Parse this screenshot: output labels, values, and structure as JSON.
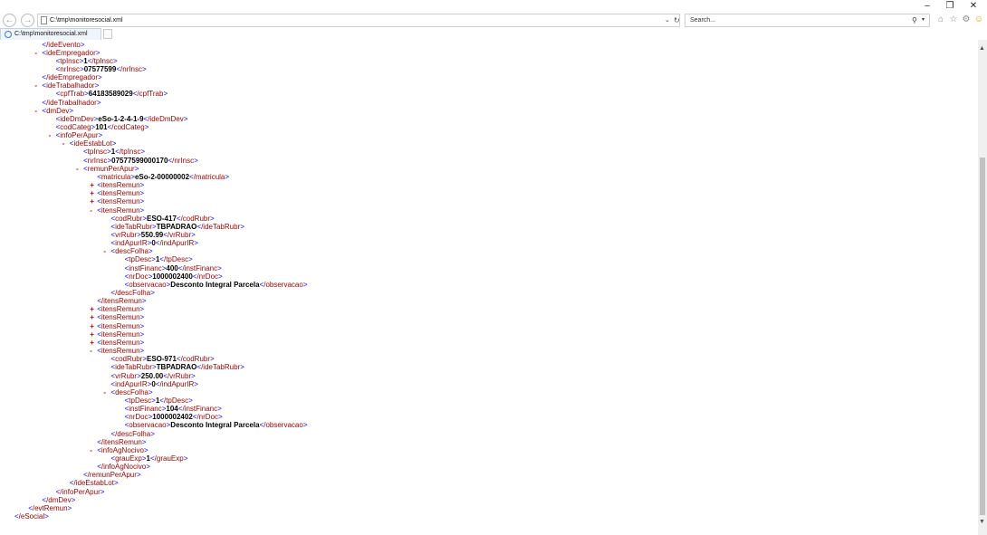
{
  "window": {
    "min_label": "–",
    "restore_label": "❐",
    "close_label": "✕"
  },
  "nav": {
    "back_label": "←",
    "forward_label": "→"
  },
  "address": {
    "url": "C:\\tmp\\monitoresocial.xml",
    "dropdown_label": "⌄",
    "refresh_label": "↻"
  },
  "search": {
    "placeholder": "Search...",
    "search_label": "⚲",
    "dropdown_label": "▾"
  },
  "toolbar_icons": {
    "home_label": "⌂",
    "favorites_label": "☆",
    "settings_label": "⚙",
    "smiley_label": "☺"
  },
  "tab": {
    "title": "C:\\tmp\\monitoresocial.xml"
  },
  "xml_lines": [
    {
      "indent": 3,
      "toggle": "",
      "open": "/ideEvento",
      "value": "",
      "close": ""
    },
    {
      "indent": 3,
      "toggle": "-",
      "open": "ideEmpregador",
      "value": "",
      "close": ""
    },
    {
      "indent": 4,
      "toggle": "",
      "open": "tpInsc",
      "value": "1",
      "close": "/tpInsc"
    },
    {
      "indent": 4,
      "toggle": "",
      "open": "nrInsc",
      "value": "07577599",
      "close": "/nrInsc"
    },
    {
      "indent": 3,
      "toggle": "",
      "open": "/ideEmpregador",
      "value": "",
      "close": ""
    },
    {
      "indent": 3,
      "toggle": "-",
      "open": "ideTrabalhador",
      "value": "",
      "close": ""
    },
    {
      "indent": 4,
      "toggle": "",
      "open": "cpfTrab",
      "value": "64183589029",
      "close": "/cpfTrab"
    },
    {
      "indent": 3,
      "toggle": "",
      "open": "/ideTrabalhador",
      "value": "",
      "close": ""
    },
    {
      "indent": 3,
      "toggle": "-",
      "open": "dmDev",
      "value": "",
      "close": ""
    },
    {
      "indent": 4,
      "toggle": "",
      "open": "ideDmDev",
      "value": "eSo-1-2-4-1-9",
      "close": "/ideDmDev"
    },
    {
      "indent": 4,
      "toggle": "",
      "open": "codCateg",
      "value": "101",
      "close": "/codCateg"
    },
    {
      "indent": 4,
      "toggle": "-",
      "open": "infoPerApur",
      "value": "",
      "close": ""
    },
    {
      "indent": 5,
      "toggle": "-",
      "open": "ideEstabLot",
      "value": "",
      "close": ""
    },
    {
      "indent": 6,
      "toggle": "",
      "open": "tpInsc",
      "value": "1",
      "close": "/tpInsc"
    },
    {
      "indent": 6,
      "toggle": "",
      "open": "nrInsc",
      "value": "07577599000170",
      "close": "/nrInsc"
    },
    {
      "indent": 6,
      "toggle": "-",
      "open": "remunPerApur",
      "value": "",
      "close": ""
    },
    {
      "indent": 7,
      "toggle": "",
      "open": "matricula",
      "value": "eSo-2-00000002",
      "close": "/matricula"
    },
    {
      "indent": 7,
      "toggle": "+",
      "open": "itensRemun",
      "value": "",
      "close": ""
    },
    {
      "indent": 7,
      "toggle": "+",
      "open": "itensRemun",
      "value": "",
      "close": ""
    },
    {
      "indent": 7,
      "toggle": "+",
      "open": "itensRemun",
      "value": "",
      "close": ""
    },
    {
      "indent": 7,
      "toggle": "-",
      "open": "itensRemun",
      "value": "",
      "close": ""
    },
    {
      "indent": 8,
      "toggle": "",
      "open": "codRubr",
      "value": "ESO-417",
      "close": "/codRubr"
    },
    {
      "indent": 8,
      "toggle": "",
      "open": "ideTabRubr",
      "value": "TBPADRAO",
      "close": "/ideTabRubr"
    },
    {
      "indent": 8,
      "toggle": "",
      "open": "vrRubr",
      "value": "550.99",
      "close": "/vrRubr"
    },
    {
      "indent": 8,
      "toggle": "",
      "open": "indApurIR",
      "value": "0",
      "close": "/indApurIR"
    },
    {
      "indent": 8,
      "toggle": "-",
      "open": "descFolha",
      "value": "",
      "close": ""
    },
    {
      "indent": 9,
      "toggle": "",
      "open": "tpDesc",
      "value": "1",
      "close": "/tpDesc"
    },
    {
      "indent": 9,
      "toggle": "",
      "open": "instFinanc",
      "value": "400",
      "close": "/instFinanc"
    },
    {
      "indent": 9,
      "toggle": "",
      "open": "nrDoc",
      "value": "1000002400",
      "close": "/nrDoc"
    },
    {
      "indent": 9,
      "toggle": "",
      "open": "observacao",
      "value": "Desconto Integral Parcela",
      "close": "/observacao"
    },
    {
      "indent": 8,
      "toggle": "",
      "open": "/descFolha",
      "value": "",
      "close": ""
    },
    {
      "indent": 7,
      "toggle": "",
      "open": "/itensRemun",
      "value": "",
      "close": ""
    },
    {
      "indent": 7,
      "toggle": "+",
      "open": "itensRemun",
      "value": "",
      "close": ""
    },
    {
      "indent": 7,
      "toggle": "+",
      "open": "itensRemun",
      "value": "",
      "close": ""
    },
    {
      "indent": 7,
      "toggle": "+",
      "open": "itensRemun",
      "value": "",
      "close": ""
    },
    {
      "indent": 7,
      "toggle": "+",
      "open": "itensRemun",
      "value": "",
      "close": ""
    },
    {
      "indent": 7,
      "toggle": "+",
      "open": "itensRemun",
      "value": "",
      "close": ""
    },
    {
      "indent": 7,
      "toggle": "-",
      "open": "itensRemun",
      "value": "",
      "close": ""
    },
    {
      "indent": 8,
      "toggle": "",
      "open": "codRubr",
      "value": "ESO-971",
      "close": "/codRubr"
    },
    {
      "indent": 8,
      "toggle": "",
      "open": "ideTabRubr",
      "value": "TBPADRAO",
      "close": "/ideTabRubr"
    },
    {
      "indent": 8,
      "toggle": "",
      "open": "vrRubr",
      "value": "250.00",
      "close": "/vrRubr"
    },
    {
      "indent": 8,
      "toggle": "",
      "open": "indApurIR",
      "value": "0",
      "close": "/indApurIR"
    },
    {
      "indent": 8,
      "toggle": "-",
      "open": "descFolha",
      "value": "",
      "close": ""
    },
    {
      "indent": 9,
      "toggle": "",
      "open": "tpDesc",
      "value": "1",
      "close": "/tpDesc"
    },
    {
      "indent": 9,
      "toggle": "",
      "open": "instFinanc",
      "value": "104",
      "close": "/instFinanc"
    },
    {
      "indent": 9,
      "toggle": "",
      "open": "nrDoc",
      "value": "1000002402",
      "close": "/nrDoc"
    },
    {
      "indent": 9,
      "toggle": "",
      "open": "observacao",
      "value": "Desconto Integral Parcela",
      "close": "/observacao"
    },
    {
      "indent": 8,
      "toggle": "",
      "open": "/descFolha",
      "value": "",
      "close": ""
    },
    {
      "indent": 7,
      "toggle": "",
      "open": "/itensRemun",
      "value": "",
      "close": ""
    },
    {
      "indent": 7,
      "toggle": "-",
      "open": "infoAgNocivo",
      "value": "",
      "close": ""
    },
    {
      "indent": 8,
      "toggle": "",
      "open": "grauExp",
      "value": "1",
      "close": "/grauExp"
    },
    {
      "indent": 7,
      "toggle": "",
      "open": "/infoAgNocivo",
      "value": "",
      "close": ""
    },
    {
      "indent": 6,
      "toggle": "",
      "open": "/remunPerApur",
      "value": "",
      "close": ""
    },
    {
      "indent": 5,
      "toggle": "",
      "open": "/ideEstabLot",
      "value": "",
      "close": ""
    },
    {
      "indent": 4,
      "toggle": "",
      "open": "/infoPerApur",
      "value": "",
      "close": ""
    },
    {
      "indent": 3,
      "toggle": "",
      "open": "/dmDev",
      "value": "",
      "close": ""
    },
    {
      "indent": 2,
      "toggle": "",
      "open": "/evtRemun",
      "value": "",
      "close": ""
    },
    {
      "indent": 1,
      "toggle": "",
      "open": "/eSocial",
      "value": "",
      "close": ""
    }
  ],
  "scrollbar": {
    "up_label": "▲",
    "down_label": "▼"
  }
}
